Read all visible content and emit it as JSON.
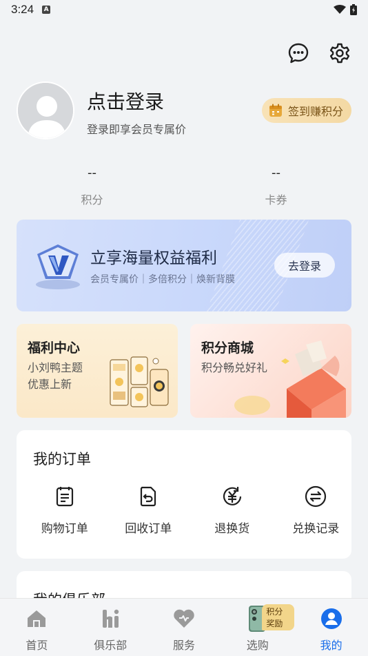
{
  "status": {
    "time": "3:24"
  },
  "profile": {
    "title": "点击登录",
    "subtitle": "登录即享会员专属价",
    "checkin_label": "签到赚积分"
  },
  "stats": [
    {
      "value": "--",
      "label": "积分"
    },
    {
      "value": "--",
      "label": "卡券"
    }
  ],
  "banner": {
    "title": "立享海量权益福利",
    "subtitle": "会员专属价｜多倍积分｜焕新背膜",
    "button": "去登录"
  },
  "cards": {
    "welfare": {
      "title": "福利中心",
      "line1": "小刘鸭主题",
      "line2": "优惠上新"
    },
    "mall": {
      "title": "积分商城",
      "subtitle": "积分畅兑好礼"
    }
  },
  "orders": {
    "title": "我的订单",
    "items": [
      {
        "label": "购物订单",
        "icon": "shopping-order-icon"
      },
      {
        "label": "回收订单",
        "icon": "recycle-order-icon"
      },
      {
        "label": "退换货",
        "icon": "return-exchange-icon"
      },
      {
        "label": "兑换记录",
        "icon": "exchange-record-icon"
      }
    ]
  },
  "club": {
    "title": "我的俱乐部"
  },
  "tabbar": {
    "items": [
      {
        "label": "首页",
        "icon": "home-icon"
      },
      {
        "label": "俱乐部",
        "icon": "club-icon"
      },
      {
        "label": "服务",
        "icon": "heart-service-icon"
      },
      {
        "label": "选购",
        "icon": "phone-shop-icon",
        "badge": "积分奖励"
      },
      {
        "label": "我的",
        "icon": "profile-icon"
      }
    ],
    "active_index": 4
  },
  "colors": {
    "accent": "#1a6eea",
    "background": "#f1f3f5",
    "checkin_bg": "#f6dcaa"
  }
}
